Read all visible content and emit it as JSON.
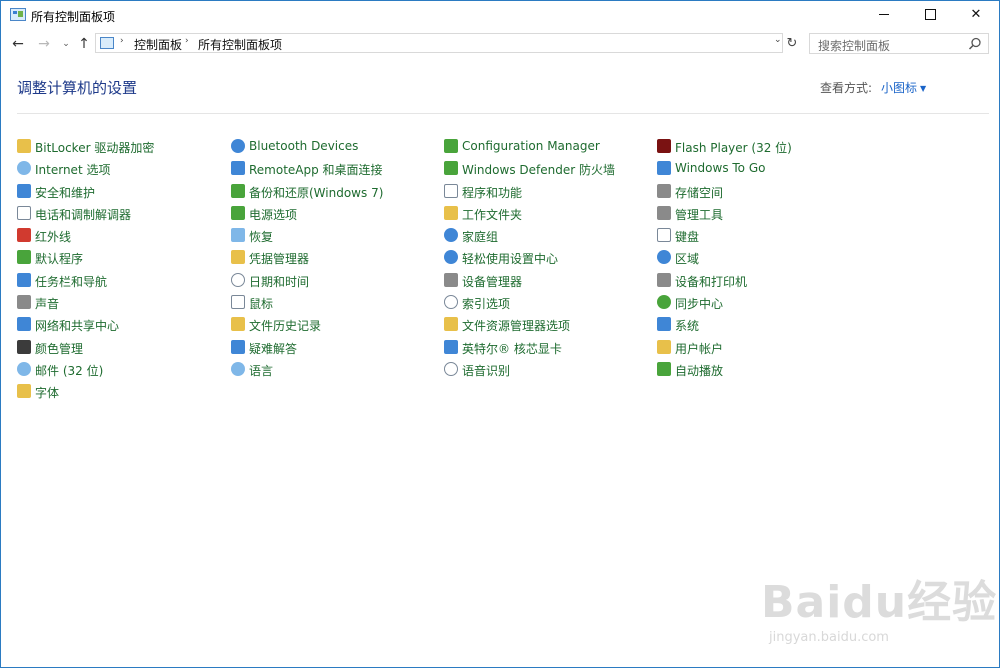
{
  "window": {
    "title": "所有控制面板项",
    "buttons": {
      "min": "minimize",
      "max": "maximize",
      "close": "✕"
    }
  },
  "nav": {
    "back": "←",
    "forward": "→",
    "recent": "⌄",
    "up": "↑",
    "breadcrumbs": [
      "控制面板",
      "所有控制面板项"
    ],
    "sep": "›",
    "dropdown": "⌄",
    "refresh": "↻",
    "search_placeholder": "搜索控制面板"
  },
  "header": {
    "title": "调整计算机的设置",
    "view_by_label": "查看方式:",
    "view_by_value": "小图标",
    "caret": "▼"
  },
  "columns": [
    [
      {
        "label": "BitLocker 驱动器加密",
        "icon": "bitlocker-icon"
      },
      {
        "label": "Internet 选项",
        "icon": "internet-options-icon"
      },
      {
        "label": "安全和维护",
        "icon": "flag-icon"
      },
      {
        "label": "电话和调制解调器",
        "icon": "modem-icon"
      },
      {
        "label": "红外线",
        "icon": "infrared-icon"
      },
      {
        "label": "默认程序",
        "icon": "default-programs-icon"
      },
      {
        "label": "任务栏和导航",
        "icon": "taskbar-icon"
      },
      {
        "label": "声音",
        "icon": "speaker-icon"
      },
      {
        "label": "网络和共享中心",
        "icon": "network-icon"
      },
      {
        "label": "颜色管理",
        "icon": "color-management-icon"
      },
      {
        "label": "邮件 (32 位)",
        "icon": "mail-icon"
      },
      {
        "label": "字体",
        "icon": "font-icon"
      }
    ],
    [
      {
        "label": "Bluetooth Devices",
        "icon": "bluetooth-icon"
      },
      {
        "label": "RemoteApp 和桌面连接",
        "icon": "remoteapp-icon"
      },
      {
        "label": "备份和还原(Windows 7)",
        "icon": "backup-icon"
      },
      {
        "label": "电源选项",
        "icon": "power-icon"
      },
      {
        "label": "恢复",
        "icon": "recovery-icon"
      },
      {
        "label": "凭据管理器",
        "icon": "credential-icon"
      },
      {
        "label": "日期和时间",
        "icon": "clock-icon"
      },
      {
        "label": "鼠标",
        "icon": "mouse-icon"
      },
      {
        "label": "文件历史记录",
        "icon": "file-history-icon"
      },
      {
        "label": "疑难解答",
        "icon": "troubleshoot-icon"
      },
      {
        "label": "语言",
        "icon": "language-icon"
      }
    ],
    [
      {
        "label": "Configuration Manager",
        "icon": "config-manager-icon"
      },
      {
        "label": "Windows Defender 防火墙",
        "icon": "firewall-icon"
      },
      {
        "label": "程序和功能",
        "icon": "programs-icon"
      },
      {
        "label": "工作文件夹",
        "icon": "work-folders-icon"
      },
      {
        "label": "家庭组",
        "icon": "homegroup-icon"
      },
      {
        "label": "轻松使用设置中心",
        "icon": "ease-of-access-icon"
      },
      {
        "label": "设备管理器",
        "icon": "device-manager-icon"
      },
      {
        "label": "索引选项",
        "icon": "indexing-icon"
      },
      {
        "label": "文件资源管理器选项",
        "icon": "folder-options-icon"
      },
      {
        "label": "英特尔® 核芯显卡",
        "icon": "intel-graphics-icon"
      },
      {
        "label": "语音识别",
        "icon": "microphone-icon"
      }
    ],
    [
      {
        "label": "Flash Player (32 位)",
        "icon": "flash-icon"
      },
      {
        "label": "Windows To Go",
        "icon": "windows-to-go-icon"
      },
      {
        "label": "存储空间",
        "icon": "storage-icon"
      },
      {
        "label": "管理工具",
        "icon": "admin-tools-icon"
      },
      {
        "label": "键盘",
        "icon": "keyboard-icon"
      },
      {
        "label": "区域",
        "icon": "region-icon"
      },
      {
        "label": "设备和打印机",
        "icon": "printer-icon"
      },
      {
        "label": "同步中心",
        "icon": "sync-icon"
      },
      {
        "label": "系统",
        "icon": "system-icon"
      },
      {
        "label": "用户帐户",
        "icon": "user-accounts-icon"
      },
      {
        "label": "自动播放",
        "icon": "autoplay-icon"
      }
    ]
  ],
  "watermark": {
    "main": "Baidu经验",
    "sub": "jingyan.baidu.com"
  }
}
